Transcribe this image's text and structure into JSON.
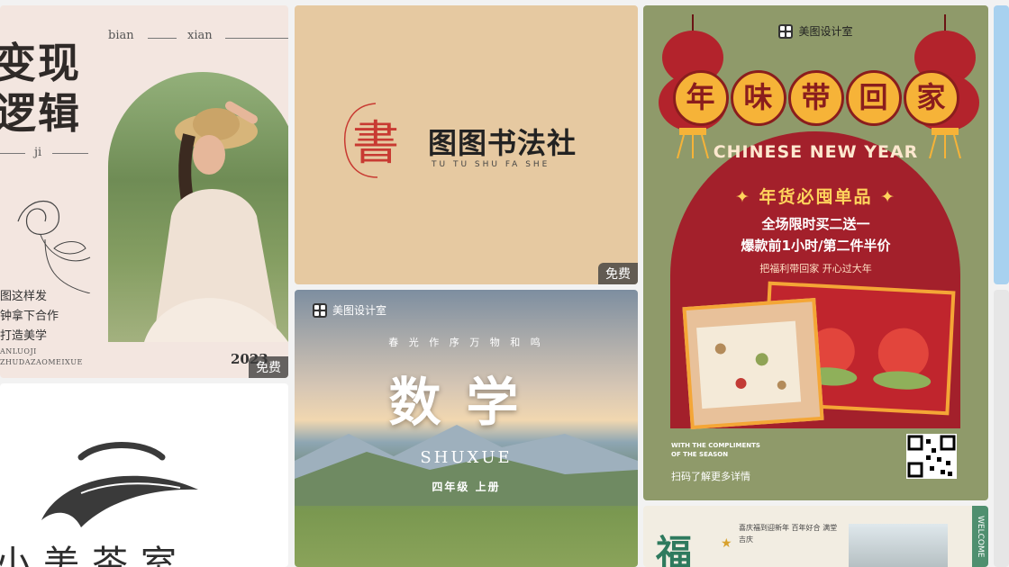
{
  "colors": {
    "page_bg": "#f2f2f2",
    "badge_bg": "#3c3c3c",
    "cny_red": "#a3202b",
    "cny_gold": "#f6b338",
    "cny_olive": "#8f9a6a",
    "calligraphy_bg": "#e6c9a1",
    "fashion_bg": "#f3e6e0"
  },
  "cards": {
    "fashion": {
      "title_line1": "变现",
      "title_line2": "逻辑",
      "pinyin_left": "bian",
      "pinyin_right": "xian",
      "pinyin_mid": "ji",
      "text_line1": "图这样发",
      "text_line2": "钟拿下合作",
      "text_line3": "打造美学",
      "small_line1": "ANLUOJI",
      "small_line2": "ZHUDAZAOMEIXUE",
      "year": "2023",
      "badge": "免费"
    },
    "calligraphy": {
      "seal": "書",
      "title": "图图书法社",
      "subtitle": "TU TU SHU FA SHE",
      "badge": "免费"
    },
    "cny": {
      "brand": "美图设计室",
      "title_chars": [
        "年",
        "味",
        "带",
        "回",
        "家"
      ],
      "english": "CHINESE NEW YEAR",
      "headline": "✦ 年货必囤单品 ✦",
      "line1": "全场限时买二送一",
      "line2": "爆款前1小时/第二件半价",
      "line3": "把福利带回家 开心过大年",
      "footer_en_1": "WITH THE COMPLIMENTS",
      "footer_en_2": "OF THE SEASON",
      "footer_cn": "扫码了解更多详情"
    },
    "math": {
      "brand": "美图设计室",
      "tagline": "春 光 作 序    万 物 和 鸣",
      "title": "数学",
      "english": "SHUXUE",
      "grade": "四年级  上册"
    },
    "tea": {
      "name": "小美茶室"
    },
    "fu": {
      "character": "福",
      "text": "喜庆福到迎新年 百年好合 满堂吉庆",
      "welcome": "WELCOME"
    }
  }
}
